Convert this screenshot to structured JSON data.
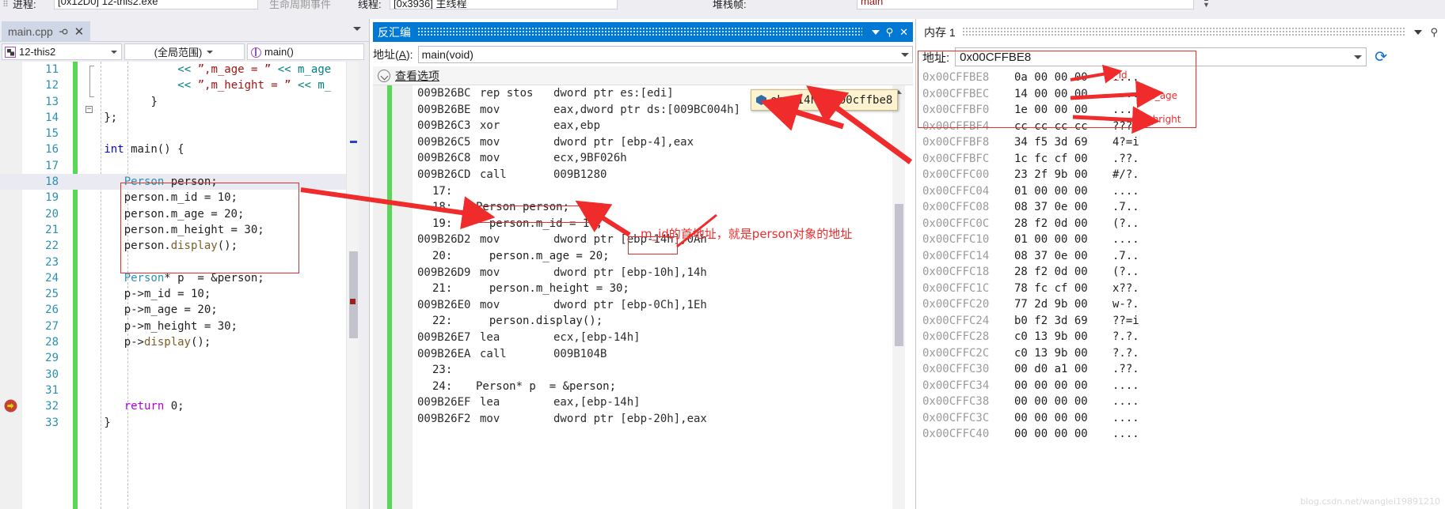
{
  "toolbar": {
    "process_label": "进程:",
    "process_value": "[0x12D0] 12-this2.exe",
    "lifecycle_label": "生命周期事件",
    "thread_label": "线程:",
    "thread_value": "[0x3936] 主线程",
    "stack_label": "堆栈帧:",
    "stack_value": "main"
  },
  "editor": {
    "tab": {
      "title": "main.cpp",
      "pin_icon": "pin-icon",
      "close_icon": "close-icon"
    },
    "nav": {
      "project": "12-this2",
      "scope": "(全局范围)",
      "function": "main()"
    },
    "lines": [
      {
        "n": "11",
        "indent": 14,
        "tokens": [
          {
            "t": "<< ",
            "c": "opr"
          },
          {
            "t": "”,m_age = ”",
            "c": "str"
          },
          {
            "t": " << m_age",
            "c": "opr"
          }
        ]
      },
      {
        "n": "12",
        "indent": 14,
        "tokens": [
          {
            "t": "<< ",
            "c": "opr"
          },
          {
            "t": "”,m_height = ”",
            "c": "str"
          },
          {
            "t": " << m_",
            "c": "opr"
          }
        ]
      },
      {
        "n": "13",
        "indent": 10,
        "tokens": [
          {
            "t": "}",
            "c": "pln"
          }
        ]
      },
      {
        "n": "14",
        "indent": 3,
        "tokens": [
          {
            "t": "};",
            "c": "pln"
          }
        ]
      },
      {
        "n": "15",
        "indent": 0,
        "tokens": []
      },
      {
        "n": "16",
        "indent": 3,
        "tokens": [
          {
            "t": "int",
            "c": "kw"
          },
          {
            "t": " main() {",
            "c": "pln"
          }
        ]
      },
      {
        "n": "17",
        "indent": 0,
        "tokens": []
      },
      {
        "n": "18",
        "indent": 6,
        "highlight": true,
        "tokens": [
          {
            "t": "Person",
            "c": "typ"
          },
          {
            "t": " person;",
            "c": "pln"
          }
        ]
      },
      {
        "n": "19",
        "indent": 6,
        "tokens": [
          {
            "t": "person.m_id = 10;",
            "c": "pln"
          }
        ]
      },
      {
        "n": "20",
        "indent": 6,
        "tokens": [
          {
            "t": "person.m_age = 20;",
            "c": "pln"
          }
        ]
      },
      {
        "n": "21",
        "indent": 6,
        "tokens": [
          {
            "t": "person.m_height = 30;",
            "c": "pln"
          }
        ]
      },
      {
        "n": "22",
        "indent": 6,
        "tokens": [
          {
            "t": "person.",
            "c": "pln"
          },
          {
            "t": "display",
            "c": "fn"
          },
          {
            "t": "();",
            "c": "pln"
          }
        ]
      },
      {
        "n": "23",
        "indent": 0,
        "tokens": []
      },
      {
        "n": "24",
        "indent": 6,
        "tokens": [
          {
            "t": "Person",
            "c": "typ"
          },
          {
            "t": "* p  = &person;",
            "c": "pln"
          }
        ]
      },
      {
        "n": "25",
        "indent": 6,
        "tokens": [
          {
            "t": "p->m_id = 10;",
            "c": "pln"
          }
        ]
      },
      {
        "n": "26",
        "indent": 6,
        "tokens": [
          {
            "t": "p->m_age = 20;",
            "c": "pln"
          }
        ]
      },
      {
        "n": "27",
        "indent": 6,
        "tokens": [
          {
            "t": "p->m_height = 30;",
            "c": "pln"
          }
        ]
      },
      {
        "n": "28",
        "indent": 6,
        "tokens": [
          {
            "t": "p->",
            "c": "pln"
          },
          {
            "t": "display",
            "c": "fn"
          },
          {
            "t": "();",
            "c": "pln"
          }
        ]
      },
      {
        "n": "29",
        "indent": 0,
        "tokens": []
      },
      {
        "n": "30",
        "indent": 0,
        "tokens": []
      },
      {
        "n": "31",
        "indent": 0,
        "tokens": []
      },
      {
        "n": "32",
        "indent": 6,
        "breakpoint": true,
        "tokens": [
          {
            "t": "return",
            "c": "kw2"
          },
          {
            "t": " 0;",
            "c": "pln"
          }
        ]
      },
      {
        "n": "33",
        "indent": 3,
        "tokens": [
          {
            "t": "}",
            "c": "pln"
          }
        ]
      }
    ]
  },
  "disassembly": {
    "title": "反汇编",
    "caret_icon": "chevron-down-icon",
    "pin_icon": "pin-icon",
    "close_icon": "close-icon",
    "address_label": "地址(A):",
    "address_value": "main(void)",
    "view_options": "查看选项",
    "rows": [
      {
        "type": "asm",
        "addr": "009B26BC",
        "mn": "rep stos",
        "op": "dword ptr es:[edi]"
      },
      {
        "type": "asm",
        "addr": "009B26BE",
        "mn": "mov",
        "op": "eax,dword ptr ds:[009BC004h]"
      },
      {
        "type": "asm",
        "addr": "009B26C3",
        "mn": "xor",
        "op": "eax,ebp"
      },
      {
        "type": "asm",
        "addr": "009B26C5",
        "mn": "mov",
        "op": "dword ptr [ebp-4],eax"
      },
      {
        "type": "asm",
        "addr": "009B26C8",
        "mn": "mov",
        "op": "ecx,9BF026h"
      },
      {
        "type": "asm",
        "addr": "009B26CD",
        "mn": "call",
        "op": "009B1280"
      },
      {
        "type": "src",
        "num": "17:",
        "text": ""
      },
      {
        "type": "src",
        "num": "18:",
        "text": "Person person;"
      },
      {
        "type": "src",
        "num": "19:",
        "text": "  person.m_id = 10;"
      },
      {
        "type": "asm",
        "addr": "009B26D2",
        "mn": "mov",
        "op": "dword ptr [ebp-14h],0Ah"
      },
      {
        "type": "src",
        "num": "20:",
        "text": "  person.m_age = 20;"
      },
      {
        "type": "asm",
        "addr": "009B26D9",
        "mn": "mov",
        "op": "dword ptr [ebp-10h],14h"
      },
      {
        "type": "src",
        "num": "21:",
        "text": "  person.m_height = 30;"
      },
      {
        "type": "asm",
        "addr": "009B26E0",
        "mn": "mov",
        "op": "dword ptr [ebp-0Ch],1Eh"
      },
      {
        "type": "src",
        "num": "22:",
        "text": "  person.display();"
      },
      {
        "type": "asm",
        "addr": "009B26E7",
        "mn": "lea",
        "op": "ecx,[ebp-14h]"
      },
      {
        "type": "asm",
        "addr": "009B26EA",
        "mn": "call",
        "op": "009B104B"
      },
      {
        "type": "src",
        "num": "23:",
        "text": ""
      },
      {
        "type": "src",
        "num": "24:",
        "text": "Person* p  = &person;"
      },
      {
        "type": "asm",
        "addr": "009B26EF",
        "mn": "lea",
        "op": "eax,[ebp-14h]"
      },
      {
        "type": "asm",
        "addr": "009B26F2",
        "mn": "mov",
        "op": "dword ptr [ebp-20h],eax"
      }
    ]
  },
  "memory": {
    "title": "内存 1",
    "caret_icon": "chevron-down-icon",
    "pin_icon": "pin-icon",
    "address_label": "地址:",
    "address_value": "0x00CFFBE8",
    "refresh_icon": "refresh-icon",
    "rows": [
      {
        "addr": "0x00CFFBE8",
        "hex": "0a 00 00 00",
        "ascii": "...."
      },
      {
        "addr": "0x00CFFBEC",
        "hex": "14 00 00 00",
        "ascii": "...."
      },
      {
        "addr": "0x00CFFBF0",
        "hex": "1e 00 00 00",
        "ascii": "...."
      },
      {
        "addr": "0x00CFFBF4",
        "hex": "cc cc cc cc",
        "ascii": "????"
      },
      {
        "addr": "0x00CFFBF8",
        "hex": "34 f5 3d 69",
        "ascii": "4?=i"
      },
      {
        "addr": "0x00CFFBFC",
        "hex": "1c fc cf 00",
        "ascii": ".??."
      },
      {
        "addr": "0x00CFFC00",
        "hex": "23 2f 9b 00",
        "ascii": "#/?."
      },
      {
        "addr": "0x00CFFC04",
        "hex": "01 00 00 00",
        "ascii": "...."
      },
      {
        "addr": "0x00CFFC08",
        "hex": "08 37 0e 00",
        "ascii": ".7.."
      },
      {
        "addr": "0x00CFFC0C",
        "hex": "28 f2 0d 00",
        "ascii": "(?.."
      },
      {
        "addr": "0x00CFFC10",
        "hex": "01 00 00 00",
        "ascii": "...."
      },
      {
        "addr": "0x00CFFC14",
        "hex": "08 37 0e 00",
        "ascii": ".7.."
      },
      {
        "addr": "0x00CFFC18",
        "hex": "28 f2 0d 00",
        "ascii": "(?.."
      },
      {
        "addr": "0x00CFFC1C",
        "hex": "78 fc cf 00",
        "ascii": "x??."
      },
      {
        "addr": "0x00CFFC20",
        "hex": "77 2d 9b 00",
        "ascii": "w-?."
      },
      {
        "addr": "0x00CFFC24",
        "hex": "b0 f2 3d 69",
        "ascii": "??=i"
      },
      {
        "addr": "0x00CFFC28",
        "hex": "c0 13 9b 00",
        "ascii": "?.?."
      },
      {
        "addr": "0x00CFFC2C",
        "hex": "c0 13 9b 00",
        "ascii": "?.?."
      },
      {
        "addr": "0x00CFFC30",
        "hex": "00 d0 a1 00",
        "ascii": ".??."
      },
      {
        "addr": "0x00CFFC34",
        "hex": "00 00 00 00",
        "ascii": "...."
      },
      {
        "addr": "0x00CFFC38",
        "hex": "00 00 00 00",
        "ascii": "...."
      },
      {
        "addr": "0x00CFFC3C",
        "hex": "00 00 00 00",
        "ascii": "...."
      },
      {
        "addr": "0x00CFFC40",
        "hex": "00 00 00 00",
        "ascii": "...."
      }
    ]
  },
  "datatip": {
    "expression": "ebp-14h",
    "value": "0x00cffbe8",
    "icon": "magnifier-icon"
  },
  "annotations": {
    "note_address": "m_id的首地址，就是person对象的地址",
    "label_m_id": "m_id",
    "label_m_age": "m_age",
    "label_m_height": "m_hright",
    "accent_red": "#ef2b2b"
  },
  "watermark": "blog.csdn.net/wanglei19891210"
}
